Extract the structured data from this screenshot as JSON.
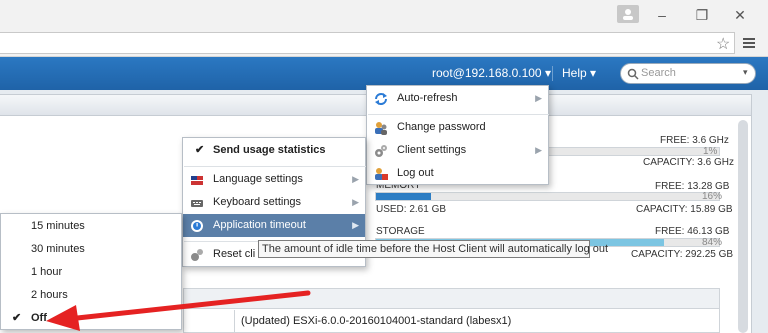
{
  "header": {
    "user": "root@192.168.0.100",
    "help": "Help",
    "search_placeholder": "Search"
  },
  "resources": {
    "cpu": {
      "free": "FREE: 3.6 GHz",
      "percent": "1%",
      "capacity": "CAPACITY: 3.6 GHz",
      "fill": 0.01
    },
    "memory": {
      "label": "MEMORY",
      "free": "FREE: 13.28 GB",
      "percent": "16%",
      "used": "USED: 2.61 GB",
      "capacity": "CAPACITY: 15.89 GB",
      "fill": 0.16
    },
    "storage": {
      "label": "STORAGE",
      "free": "FREE: 46.13 GB",
      "percent": "84%",
      "capacity": "CAPACITY: 292.25 GB",
      "fill": 0.84
    }
  },
  "user_menu": {
    "items": [
      {
        "label": "Auto-refresh",
        "icon": "refresh-icon"
      },
      {
        "label": "Change password",
        "icon": "users-icon"
      },
      {
        "label": "Client settings",
        "icon": "gears-icon"
      },
      {
        "label": "Log out",
        "icon": "logout-icon"
      }
    ]
  },
  "settings_menu": {
    "send_usage": "Send usage statistics",
    "language": "Language settings",
    "keyboard": "Keyboard settings",
    "timeout": "Application timeout",
    "reset": "Reset cli"
  },
  "timeout_menu": {
    "options": [
      "15 minutes",
      "30 minutes",
      "1 hour",
      "2 hours",
      "Off"
    ],
    "selected": "Off"
  },
  "tooltip": "The amount of idle time before the Host Client will automatically log out",
  "table": {
    "version": "(Updated) ESXi-6.0.0-20160104001-standard (labesx1)"
  },
  "colors": {
    "header_blue": "#1f63a8",
    "bar_blue": "#2d7ec4",
    "storage_bar": "#7cc5e2",
    "highlight": "#5b7fa8",
    "arrow_red": "#e52222"
  }
}
